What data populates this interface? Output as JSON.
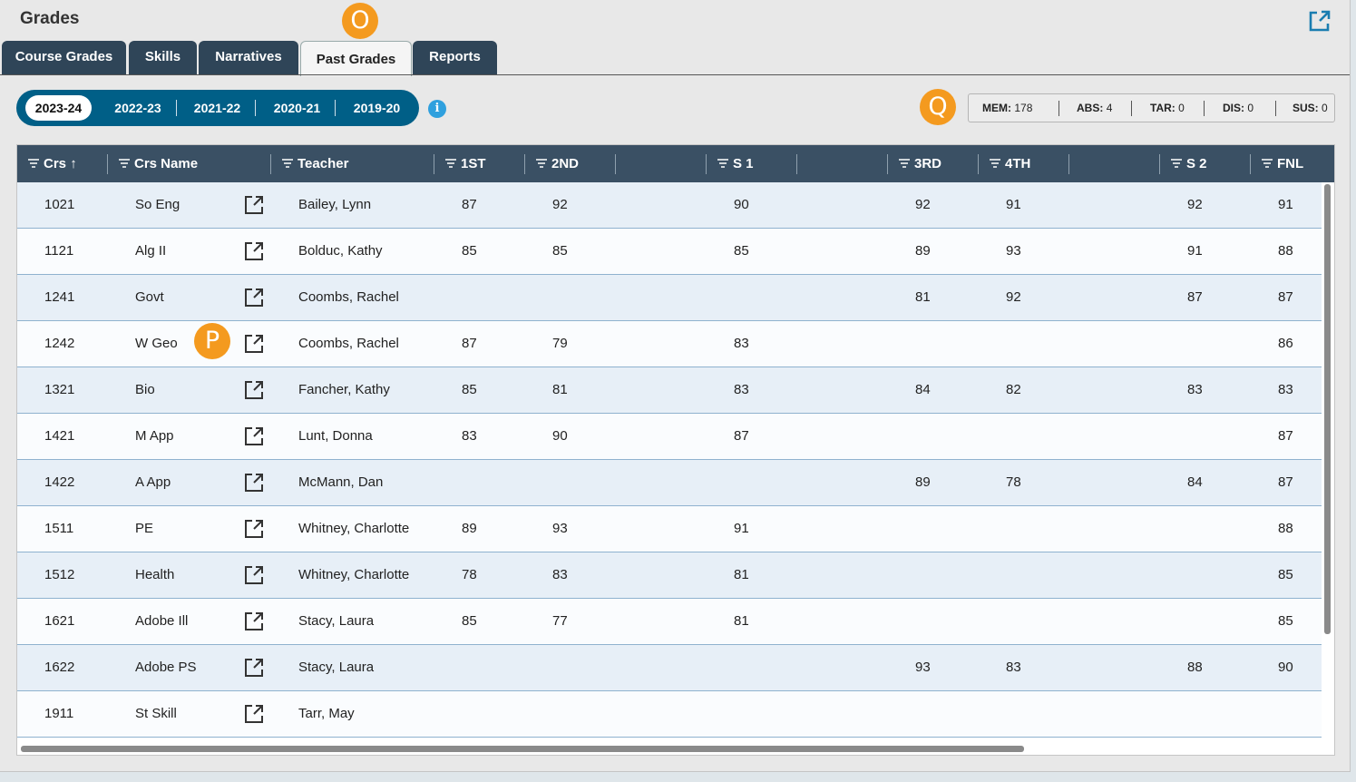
{
  "app": {
    "title": "Grades"
  },
  "markers": {
    "o": "O",
    "p": "P",
    "q": "Q"
  },
  "tabs": [
    "Course Grades",
    "Skills",
    "Narratives",
    "Past Grades",
    "Reports"
  ],
  "active_tab": "Past Grades",
  "years": [
    "2023-24",
    "2022-23",
    "2021-22",
    "2020-21",
    "2019-20"
  ],
  "active_year": "2023-24",
  "info_glyph": "i",
  "stats": [
    {
      "label": "MEM:",
      "value": "178"
    },
    {
      "label": "ABS:",
      "value": "4"
    },
    {
      "label": "TAR:",
      "value": "0"
    },
    {
      "label": "DIS:",
      "value": "0"
    },
    {
      "label": "SUS:",
      "value": "0"
    }
  ],
  "table": {
    "sort_indicator": "↑",
    "columns": [
      "Crs",
      "Crs Name",
      "Teacher",
      "1ST",
      "2ND",
      "",
      "S 1",
      "",
      "3RD",
      "4TH",
      "",
      "S 2",
      "FNL"
    ],
    "rows": [
      {
        "crs": "1021",
        "name": "So Eng",
        "teacher": "Bailey, Lynn",
        "q1": "87",
        "q2": "92",
        "s1": "90",
        "q3": "92",
        "q4": "91",
        "s2": "92",
        "fnl": "91"
      },
      {
        "crs": "1121",
        "name": "Alg II",
        "teacher": "Bolduc, Kathy",
        "q1": "85",
        "q2": "85",
        "s1": "85",
        "q3": "89",
        "q4": "93",
        "s2": "91",
        "fnl": "88"
      },
      {
        "crs": "1241",
        "name": "Govt",
        "teacher": "Coombs, Rachel",
        "q1": "",
        "q2": "",
        "s1": "",
        "q3": "81",
        "q4": "92",
        "s2": "87",
        "fnl": "87"
      },
      {
        "crs": "1242",
        "name": "W Geo",
        "teacher": "Coombs, Rachel",
        "q1": "87",
        "q2": "79",
        "s1": "83",
        "q3": "",
        "q4": "",
        "s2": "",
        "fnl": "86"
      },
      {
        "crs": "1321",
        "name": "Bio",
        "teacher": "Fancher, Kathy",
        "q1": "85",
        "q2": "81",
        "s1": "83",
        "q3": "84",
        "q4": "82",
        "s2": "83",
        "fnl": "83"
      },
      {
        "crs": "1421",
        "name": "M App",
        "teacher": "Lunt, Donna",
        "q1": "83",
        "q2": "90",
        "s1": "87",
        "q3": "",
        "q4": "",
        "s2": "",
        "fnl": "87"
      },
      {
        "crs": "1422",
        "name": "A App",
        "teacher": "McMann, Dan",
        "q1": "",
        "q2": "",
        "s1": "",
        "q3": "89",
        "q4": "78",
        "s2": "84",
        "fnl": "87"
      },
      {
        "crs": "1511",
        "name": "PE",
        "teacher": "Whitney, Charlotte",
        "q1": "89",
        "q2": "93",
        "s1": "91",
        "q3": "",
        "q4": "",
        "s2": "",
        "fnl": "88"
      },
      {
        "crs": "1512",
        "name": "Health",
        "teacher": "Whitney, Charlotte",
        "q1": "78",
        "q2": "83",
        "s1": "81",
        "q3": "",
        "q4": "",
        "s2": "",
        "fnl": "85"
      },
      {
        "crs": "1621",
        "name": "Adobe Ill",
        "teacher": "Stacy, Laura",
        "q1": "85",
        "q2": "77",
        "s1": "81",
        "q3": "",
        "q4": "",
        "s2": "",
        "fnl": "85"
      },
      {
        "crs": "1622",
        "name": "Adobe PS",
        "teacher": "Stacy, Laura",
        "q1": "",
        "q2": "",
        "s1": "",
        "q3": "93",
        "q4": "83",
        "s2": "88",
        "fnl": "90"
      },
      {
        "crs": "1911",
        "name": "St Skill",
        "teacher": "Tarr, May",
        "q1": "",
        "q2": "",
        "s1": "",
        "q3": "",
        "q4": "",
        "s2": "",
        "fnl": ""
      }
    ]
  },
  "icons": {
    "open_external": "external-link-icon",
    "filter": "filter-icon",
    "info": "info-icon"
  },
  "colors": {
    "tab_bg": "#2f4558",
    "year_pill": "#005f87",
    "header_bg": "#3a5064",
    "row_alt": "#e7eff7",
    "marker": "#f49a1f",
    "link": "#1a7db0"
  }
}
